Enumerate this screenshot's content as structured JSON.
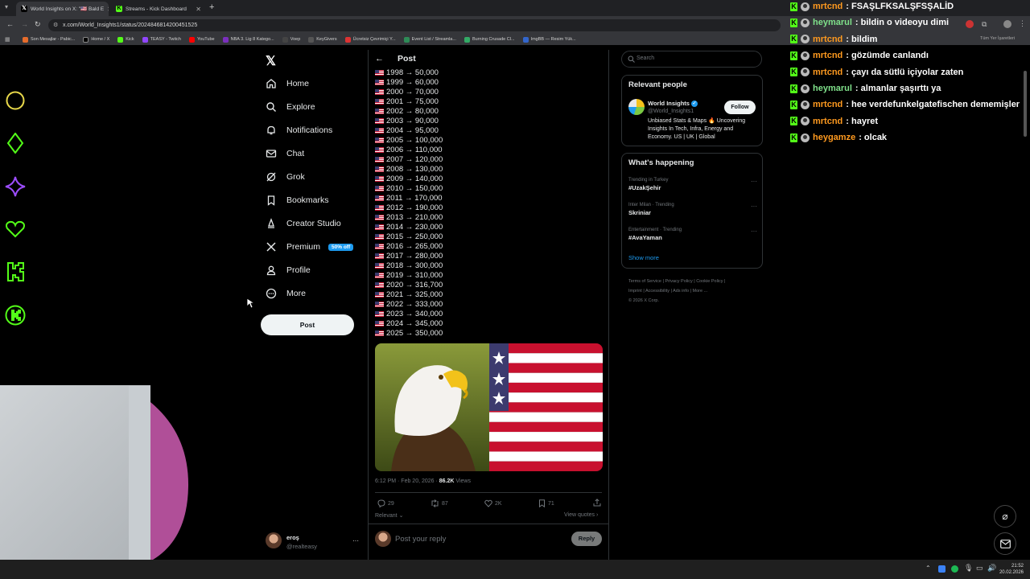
{
  "browser": {
    "tabs": [
      {
        "title": "World Insights on X: \"🇺🇸 Bald E",
        "active": true
      },
      {
        "title": "Streams - Kick Dashboard",
        "active": false
      }
    ],
    "url": "x.com/World_Insights1/status/2024846814200451525",
    "bookmarks": [
      "Son Mesajlar - Pabic...",
      "Home / X",
      "Kick",
      "TEASY - Twitch",
      "YouTube",
      "NBA 3. Lig 8 Katego...",
      "Voep",
      "KeyGivers",
      "Ücretsiz Çevrimiçi Y...",
      "Event List / Streamla...",
      "Burning Crusade Cl...",
      "ImgBB — Resim Yük..."
    ],
    "bookmarks_right": "Tüm Yer İşaretleri"
  },
  "sidebar": {
    "items": [
      {
        "label": "Home",
        "icon": "home-icon"
      },
      {
        "label": "Explore",
        "icon": "search-icon"
      },
      {
        "label": "Notifications",
        "icon": "bell-icon"
      },
      {
        "label": "Chat",
        "icon": "mail-icon"
      },
      {
        "label": "Grok",
        "icon": "grok-icon"
      },
      {
        "label": "Bookmarks",
        "icon": "bookmark-icon"
      },
      {
        "label": "Creator Studio",
        "icon": "creator-icon"
      },
      {
        "label": "Premium",
        "icon": "x-icon"
      },
      {
        "label": "Profile",
        "icon": "person-icon"
      },
      {
        "label": "More",
        "icon": "more-icon"
      }
    ],
    "premium_badge": "50% off",
    "post_button": "Post",
    "account": {
      "name": "eroş",
      "handle": "@realteasy",
      "menu": "···"
    }
  },
  "post": {
    "header": "Post",
    "lines": [
      "1998 → 50,000",
      "1999 → 60,000",
      "2000 → 70,000",
      "2001 → 75,000",
      "2002 → 80,000",
      "2003 → 90,000",
      "2004 → 95,000",
      "2005 → 100,000",
      "2006 → 110,000",
      "2007 → 120,000",
      "2008 → 130,000",
      "2009 → 140,000",
      "2010 → 150,000",
      "2011 → 170,000",
      "2012 → 190,000",
      "2013 → 210,000",
      "2014 → 230,000",
      "2015 → 250,000",
      "2016 → 265,000",
      "2017 → 280,000",
      "2018 → 300,000",
      "2019 → 310,000",
      "2020 → 316,700",
      "2021 → 325,000",
      "2022 → 333,000",
      "2023 → 340,000",
      "2024 → 345,000",
      "2025 → 350,000"
    ],
    "timestamp": "6:12 PM · Feb 20, 2026 · ",
    "views_count": "86.2K",
    "views_label": "Views",
    "replies": "29",
    "reposts": "87",
    "likes": "2K",
    "bookmarks": "71",
    "sort": "Relevant",
    "view_quotes": "View quotes",
    "reply_placeholder": "Post your reply",
    "reply_button": "Reply"
  },
  "right": {
    "search_placeholder": "Search",
    "relevant_title": "Relevant people",
    "person": {
      "name": "World Insights",
      "handle": "@World_Insights1",
      "follow": "Follow",
      "bio": "Unbiased Stats & Maps 🔥 Uncovering Insights In Tech, Infra, Energy and Economy. US | UK | Global"
    },
    "happening_title": "What's happening",
    "trends": [
      {
        "context": "Trending in Turkey",
        "title": "#UzakŞehir"
      },
      {
        "context": "Inter Milan · Trending",
        "title": "Skriniar"
      },
      {
        "context": "Entertainment · Trending",
        "title": "#AvaYaman"
      }
    ],
    "show_more": "Show more",
    "footer": [
      "Terms of Service",
      "Privacy Policy",
      "Cookie Policy",
      "Imprint",
      "Accessibility",
      "Ads info",
      "More ...",
      "© 2026 X Corp."
    ]
  },
  "chat": {
    "messages": [
      {
        "user": "mrtcnd",
        "text": ": FSAŞLFKSALŞFSŞALİD",
        "color": "#ff9a1f"
      },
      {
        "user": "heymarul",
        "text": ": bildin o videoyu dimi",
        "color": "#7fe08a"
      },
      {
        "user": "mrtcnd",
        "text": ": bildim",
        "color": "#ff9a1f"
      },
      {
        "user": "mrtcnd",
        "text": ": gözümde canlandı",
        "color": "#ff9a1f"
      },
      {
        "user": "mrtcnd",
        "text": ": çayı da sütlü içiyolar zaten",
        "color": "#ff9a1f"
      },
      {
        "user": "heymarul",
        "text": ": almanlar şaşırttı ya",
        "color": "#7fe08a"
      },
      {
        "user": "mrtcnd",
        "text": ": hee verdefunkelgatefischen dememişler",
        "color": "#ff9a1f"
      },
      {
        "user": "mrtcnd",
        "text": ": hayret",
        "color": "#ff9a1f"
      },
      {
        "user": "heygamze",
        "text": ": olcak",
        "color": "#ff9a1f"
      }
    ]
  },
  "taskbar": {
    "time": "21:52",
    "date": "20.02.2026"
  },
  "colors": {
    "accent": "#1d9bf0",
    "kick_green": "#53fc18",
    "background": "#000000"
  }
}
